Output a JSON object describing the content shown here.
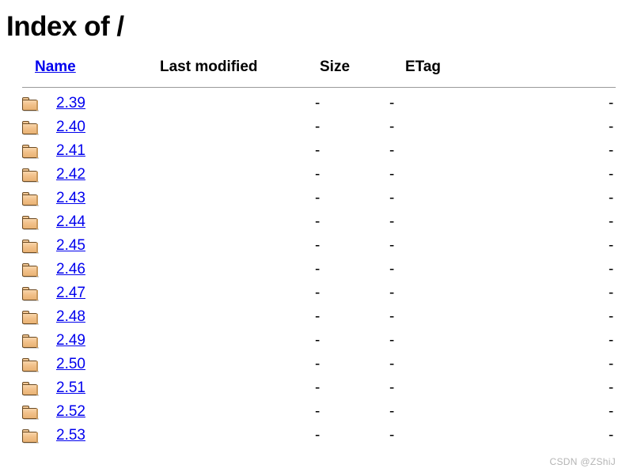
{
  "page": {
    "title": "Index of /",
    "watermark": "CSDN @ZShiJ",
    "link_color": "#0000ee",
    "rule_color": "#9a9a9a",
    "folder_icon_color": "#f2c18a",
    "folder_icon_outline": "#6b4a22"
  },
  "table": {
    "columns": [
      {
        "key": "icon",
        "label": "",
        "is_link": false
      },
      {
        "key": "name",
        "label": "Name",
        "is_link": true
      },
      {
        "key": "last_modified",
        "label": "Last modified",
        "is_link": false
      },
      {
        "key": "size",
        "label": "Size",
        "is_link": false
      },
      {
        "key": "etag",
        "label": "ETag",
        "is_link": false
      }
    ],
    "headers": {
      "name": "Name",
      "last_modified": "Last modified",
      "size": "Size",
      "etag": "ETag"
    },
    "rows": [
      {
        "icon": "folder-icon",
        "name": "2.39",
        "last_modified": "-",
        "size": "-",
        "etag": "-"
      },
      {
        "icon": "folder-icon",
        "name": "2.40",
        "last_modified": "-",
        "size": "-",
        "etag": "-"
      },
      {
        "icon": "folder-icon",
        "name": "2.41",
        "last_modified": "-",
        "size": "-",
        "etag": "-"
      },
      {
        "icon": "folder-icon",
        "name": "2.42",
        "last_modified": "-",
        "size": "-",
        "etag": "-"
      },
      {
        "icon": "folder-icon",
        "name": "2.43",
        "last_modified": "-",
        "size": "-",
        "etag": "-"
      },
      {
        "icon": "folder-icon",
        "name": "2.44",
        "last_modified": "-",
        "size": "-",
        "etag": "-"
      },
      {
        "icon": "folder-icon",
        "name": "2.45",
        "last_modified": "-",
        "size": "-",
        "etag": "-"
      },
      {
        "icon": "folder-icon",
        "name": "2.46",
        "last_modified": "-",
        "size": "-",
        "etag": "-"
      },
      {
        "icon": "folder-icon",
        "name": "2.47",
        "last_modified": "-",
        "size": "-",
        "etag": "-"
      },
      {
        "icon": "folder-icon",
        "name": "2.48",
        "last_modified": "-",
        "size": "-",
        "etag": "-"
      },
      {
        "icon": "folder-icon",
        "name": "2.49",
        "last_modified": "-",
        "size": "-",
        "etag": "-"
      },
      {
        "icon": "folder-icon",
        "name": "2.50",
        "last_modified": "-",
        "size": "-",
        "etag": "-"
      },
      {
        "icon": "folder-icon",
        "name": "2.51",
        "last_modified": "-",
        "size": "-",
        "etag": "-"
      },
      {
        "icon": "folder-icon",
        "name": "2.52",
        "last_modified": "-",
        "size": "-",
        "etag": "-"
      },
      {
        "icon": "folder-icon",
        "name": "2.53",
        "last_modified": "-",
        "size": "-",
        "etag": "-"
      }
    ]
  }
}
